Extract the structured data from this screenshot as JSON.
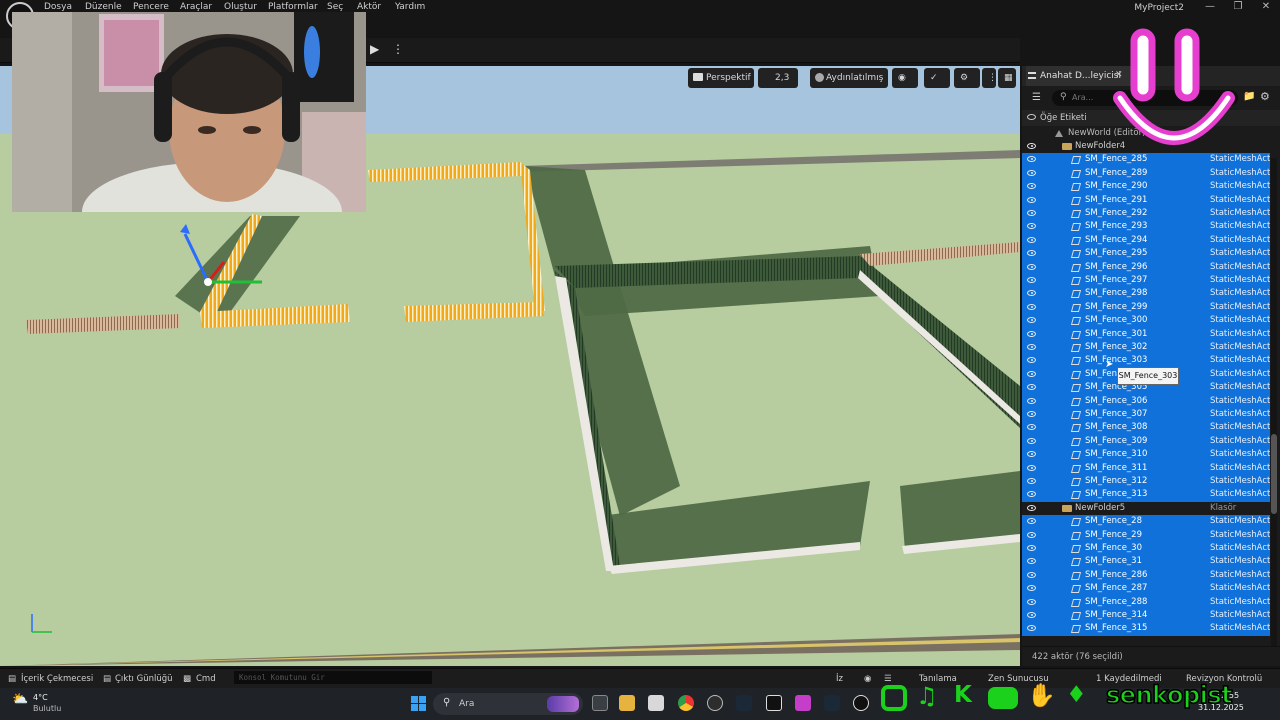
{
  "menu": {
    "items": [
      "Dosya",
      "Düzenle",
      "Pencere",
      "Araçlar",
      "Oluştur",
      "Platformlar",
      "Seç",
      "Aktör",
      "Yardım"
    ],
    "project_title": "MyProject2"
  },
  "viewport": {
    "view_mode": "Perspektif",
    "grid_value": "2,3",
    "lighting": "Aydınlatılmış"
  },
  "outliner": {
    "tab_title": "Anahat D...leyicisi",
    "search_placeholder": "Ara...",
    "column_label": "Öğe Etiketi",
    "world_label": "NewWorld (Editör)",
    "rows": [
      {
        "name": "NewFolder4",
        "type": "",
        "kind": "folder",
        "indent": 1
      },
      {
        "name": "SM_Fence_285",
        "type": "StaticMeshActor",
        "kind": "mesh",
        "indent": 2
      },
      {
        "name": "SM_Fence_289",
        "type": "StaticMeshActor",
        "kind": "mesh",
        "indent": 2
      },
      {
        "name": "SM_Fence_290",
        "type": "StaticMeshActor",
        "kind": "mesh",
        "indent": 2
      },
      {
        "name": "SM_Fence_291",
        "type": "StaticMeshActor",
        "kind": "mesh",
        "indent": 2
      },
      {
        "name": "SM_Fence_292",
        "type": "StaticMeshActor",
        "kind": "mesh",
        "indent": 2
      },
      {
        "name": "SM_Fence_293",
        "type": "StaticMeshActor",
        "kind": "mesh",
        "indent": 2
      },
      {
        "name": "SM_Fence_294",
        "type": "StaticMeshActor",
        "kind": "mesh",
        "indent": 2
      },
      {
        "name": "SM_Fence_295",
        "type": "StaticMeshActor",
        "kind": "mesh",
        "indent": 2
      },
      {
        "name": "SM_Fence_296",
        "type": "StaticMeshActor",
        "kind": "mesh",
        "indent": 2
      },
      {
        "name": "SM_Fence_297",
        "type": "StaticMeshActor",
        "kind": "mesh",
        "indent": 2
      },
      {
        "name": "SM_Fence_298",
        "type": "StaticMeshActor",
        "kind": "mesh",
        "indent": 2
      },
      {
        "name": "SM_Fence_299",
        "type": "StaticMeshActor",
        "kind": "mesh",
        "indent": 2
      },
      {
        "name": "SM_Fence_300",
        "type": "StaticMeshActor",
        "kind": "mesh",
        "indent": 2
      },
      {
        "name": "SM_Fence_301",
        "type": "StaticMeshActor",
        "kind": "mesh",
        "indent": 2
      },
      {
        "name": "SM_Fence_302",
        "type": "StaticMeshActor",
        "kind": "mesh",
        "indent": 2
      },
      {
        "name": "SM_Fence_303",
        "type": "StaticMeshActor",
        "kind": "mesh",
        "indent": 2
      },
      {
        "name": "SM_Fence_304",
        "type": "StaticMeshActor",
        "kind": "mesh",
        "indent": 2
      },
      {
        "name": "SM_Fence_305",
        "type": "StaticMeshActor",
        "kind": "mesh",
        "indent": 2
      },
      {
        "name": "SM_Fence_306",
        "type": "StaticMeshActor",
        "kind": "mesh",
        "indent": 2
      },
      {
        "name": "SM_Fence_307",
        "type": "StaticMeshActor",
        "kind": "mesh",
        "indent": 2
      },
      {
        "name": "SM_Fence_308",
        "type": "StaticMeshActor",
        "kind": "mesh",
        "indent": 2
      },
      {
        "name": "SM_Fence_309",
        "type": "StaticMeshActor",
        "kind": "mesh",
        "indent": 2
      },
      {
        "name": "SM_Fence_310",
        "type": "StaticMeshActor",
        "kind": "mesh",
        "indent": 2
      },
      {
        "name": "SM_Fence_311",
        "type": "StaticMeshActor",
        "kind": "mesh",
        "indent": 2
      },
      {
        "name": "SM_Fence_312",
        "type": "StaticMeshActor",
        "kind": "mesh",
        "indent": 2
      },
      {
        "name": "SM_Fence_313",
        "type": "StaticMeshActor",
        "kind": "mesh",
        "indent": 2
      },
      {
        "name": "NewFolder5",
        "type": "Klasör",
        "kind": "folder",
        "indent": 1
      },
      {
        "name": "SM_Fence_28",
        "type": "StaticMeshActor",
        "kind": "mesh",
        "indent": 2
      },
      {
        "name": "SM_Fence_29",
        "type": "StaticMeshActor",
        "kind": "mesh",
        "indent": 2
      },
      {
        "name": "SM_Fence_30",
        "type": "StaticMeshActor",
        "kind": "mesh",
        "indent": 2
      },
      {
        "name": "SM_Fence_31",
        "type": "StaticMeshActor",
        "kind": "mesh",
        "indent": 2
      },
      {
        "name": "SM_Fence_286",
        "type": "StaticMeshActor",
        "kind": "mesh",
        "indent": 2
      },
      {
        "name": "SM_Fence_287",
        "type": "StaticMeshActor",
        "kind": "mesh",
        "indent": 2
      },
      {
        "name": "SM_Fence_288",
        "type": "StaticMeshActor",
        "kind": "mesh",
        "indent": 2
      },
      {
        "name": "SM_Fence_314",
        "type": "StaticMeshActor",
        "kind": "mesh",
        "indent": 2
      },
      {
        "name": "SM_Fence_315",
        "type": "StaticMeshActor",
        "kind": "mesh",
        "indent": 2
      }
    ],
    "footer": "422 aktör (76 seçildi)",
    "tooltip": "SM_Fence_303"
  },
  "statusbar": {
    "content_drawer": "İçerik Çekmecesi",
    "output_log": "Çıktı Günlüğü",
    "cmd": "Cmd",
    "console_placeholder": "Konsol Komutunu Gir",
    "trace": "İz",
    "derive": "Tanılama",
    "zen": "Zen Sunucusu",
    "unsaved": "1 Kaydedilmedi",
    "revision": "Revizyon Kontrolü"
  },
  "taskbar": {
    "weather_temp": "4°C",
    "weather_desc": "Bulutlu",
    "search_label": "Ara",
    "time": "12:55",
    "date": "31.12.2025"
  },
  "brand": {
    "handle": "senkopist"
  },
  "colors": {
    "selection": "#0f71d9",
    "ground": "#b7cc9f",
    "sky": "#a7c4de",
    "fence_selected": "#f0a81c",
    "brand_green": "#1bd11b",
    "smiley_pink": "#e63fcf"
  }
}
